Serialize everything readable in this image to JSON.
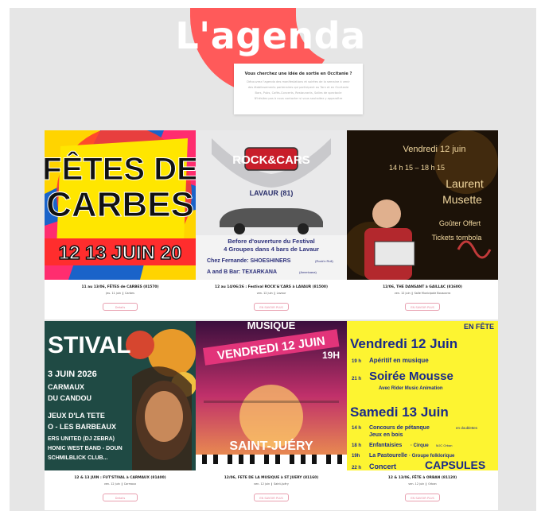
{
  "header": {
    "title": "L'agenda"
  },
  "intro": {
    "heading": "Vous cherchez une idée de sortie en Occitanie ?",
    "lines": [
      "Découvrez l'agenda des manifestations et soirées de la semaine à venir",
      "des établissements partenaires qui participent au Tarn et en Occitanie",
      "Bars, Pubs, Cafés-Concerts, Restaurants, Salles de spectacle",
      "N'hésitez pas à nous contacter si vous souhaitez y apparaître"
    ]
  },
  "events": [
    {
      "title": "11 au 13/06, FÊTES de CARBES (81570)",
      "meta": "jeu. 11 juin  ❙  Carbes",
      "button": "Details",
      "poster_text": [
        "FÊTES DE",
        "CARBES",
        "12 13 JUIN 20"
      ]
    },
    {
      "title": "12 au 14/06/26 : Festival ROCK'&'CARS à LAVAUR (81500)",
      "meta": "ven. 12 juin  ❙  Lavaur",
      "button": "EN SAVOIR PLUS",
      "poster_text": [
        "ROCK&CARS",
        "LAVAUR (81)",
        "Before d'ouverture du Festival",
        "4 Groupes dans 4 bars de Lavaur",
        "Chez Fernande: SHOESHINERS",
        "(Rock'n Roll)",
        "A and B Bar: TEXARKANA",
        "(Americana)"
      ]
    },
    {
      "title": "12/06, THE DANSANT à GAILLAC (81600)",
      "meta": "ven. 12 juin  ❙  Salle Municipale Bouscarra",
      "button": "EN SAVOIR PLUS",
      "poster_text": [
        "Vendredi 12 juin",
        "14 h 15 – 18 h 15",
        "Laurent",
        "Musette",
        "Goûter Offert",
        "Tickets tombola"
      ]
    },
    {
      "title": "12 & 13 JUIN : FUT'STIVAL à CARMAUX (81400)",
      "meta": "ven. 12 juin  ❙  Carmaux",
      "button": "Details",
      "poster_text": [
        "STIVAL",
        "3 JUIN 2026",
        "CARMAUX",
        "DU CANDOU",
        "JEUX D'LA TETE",
        "O - LES BARBEAUX",
        "ERS UNITED (DJ ZEBRA)",
        "HONIC WEST BAND - DOUN",
        "SCHMILBLICK CLUB..."
      ]
    },
    {
      "title": "12/06, FETE DE LA MUSIQUE à ST JUERY (81160)",
      "meta": "ven. 12 juin  ❙  Saint-Juéry",
      "button": "EN SAVOIR PLUS",
      "poster_text": [
        "MUSIQUE",
        "VENDREDI 12 JUIN",
        "19H",
        "SAINT-JUÉRY"
      ]
    },
    {
      "title": "12 & 13/06, FÊTE à ORBAN (81120)",
      "meta": "ven. 12 juin  ❙  Orban",
      "button": "EN SAVOIR PLUS",
      "poster_text": [
        "EN FÊTE",
        "Vendredi 12 Juin",
        "19 h",
        "Apéritif en musique",
        "21 h",
        "Soirée Mousse",
        "Avec Rider Music Animation",
        "Samedi 13 Juin",
        "14 h",
        "Concours de pétanque",
        "en doublettes",
        "Jeux en bois",
        "18 h",
        "Enfantaisies",
        "· Cirque",
        "MJC Orban",
        "19h",
        "La Pastourelle",
        "· Groupe folklorique",
        "22 h",
        "Concert",
        "CAPSULES"
      ]
    }
  ]
}
